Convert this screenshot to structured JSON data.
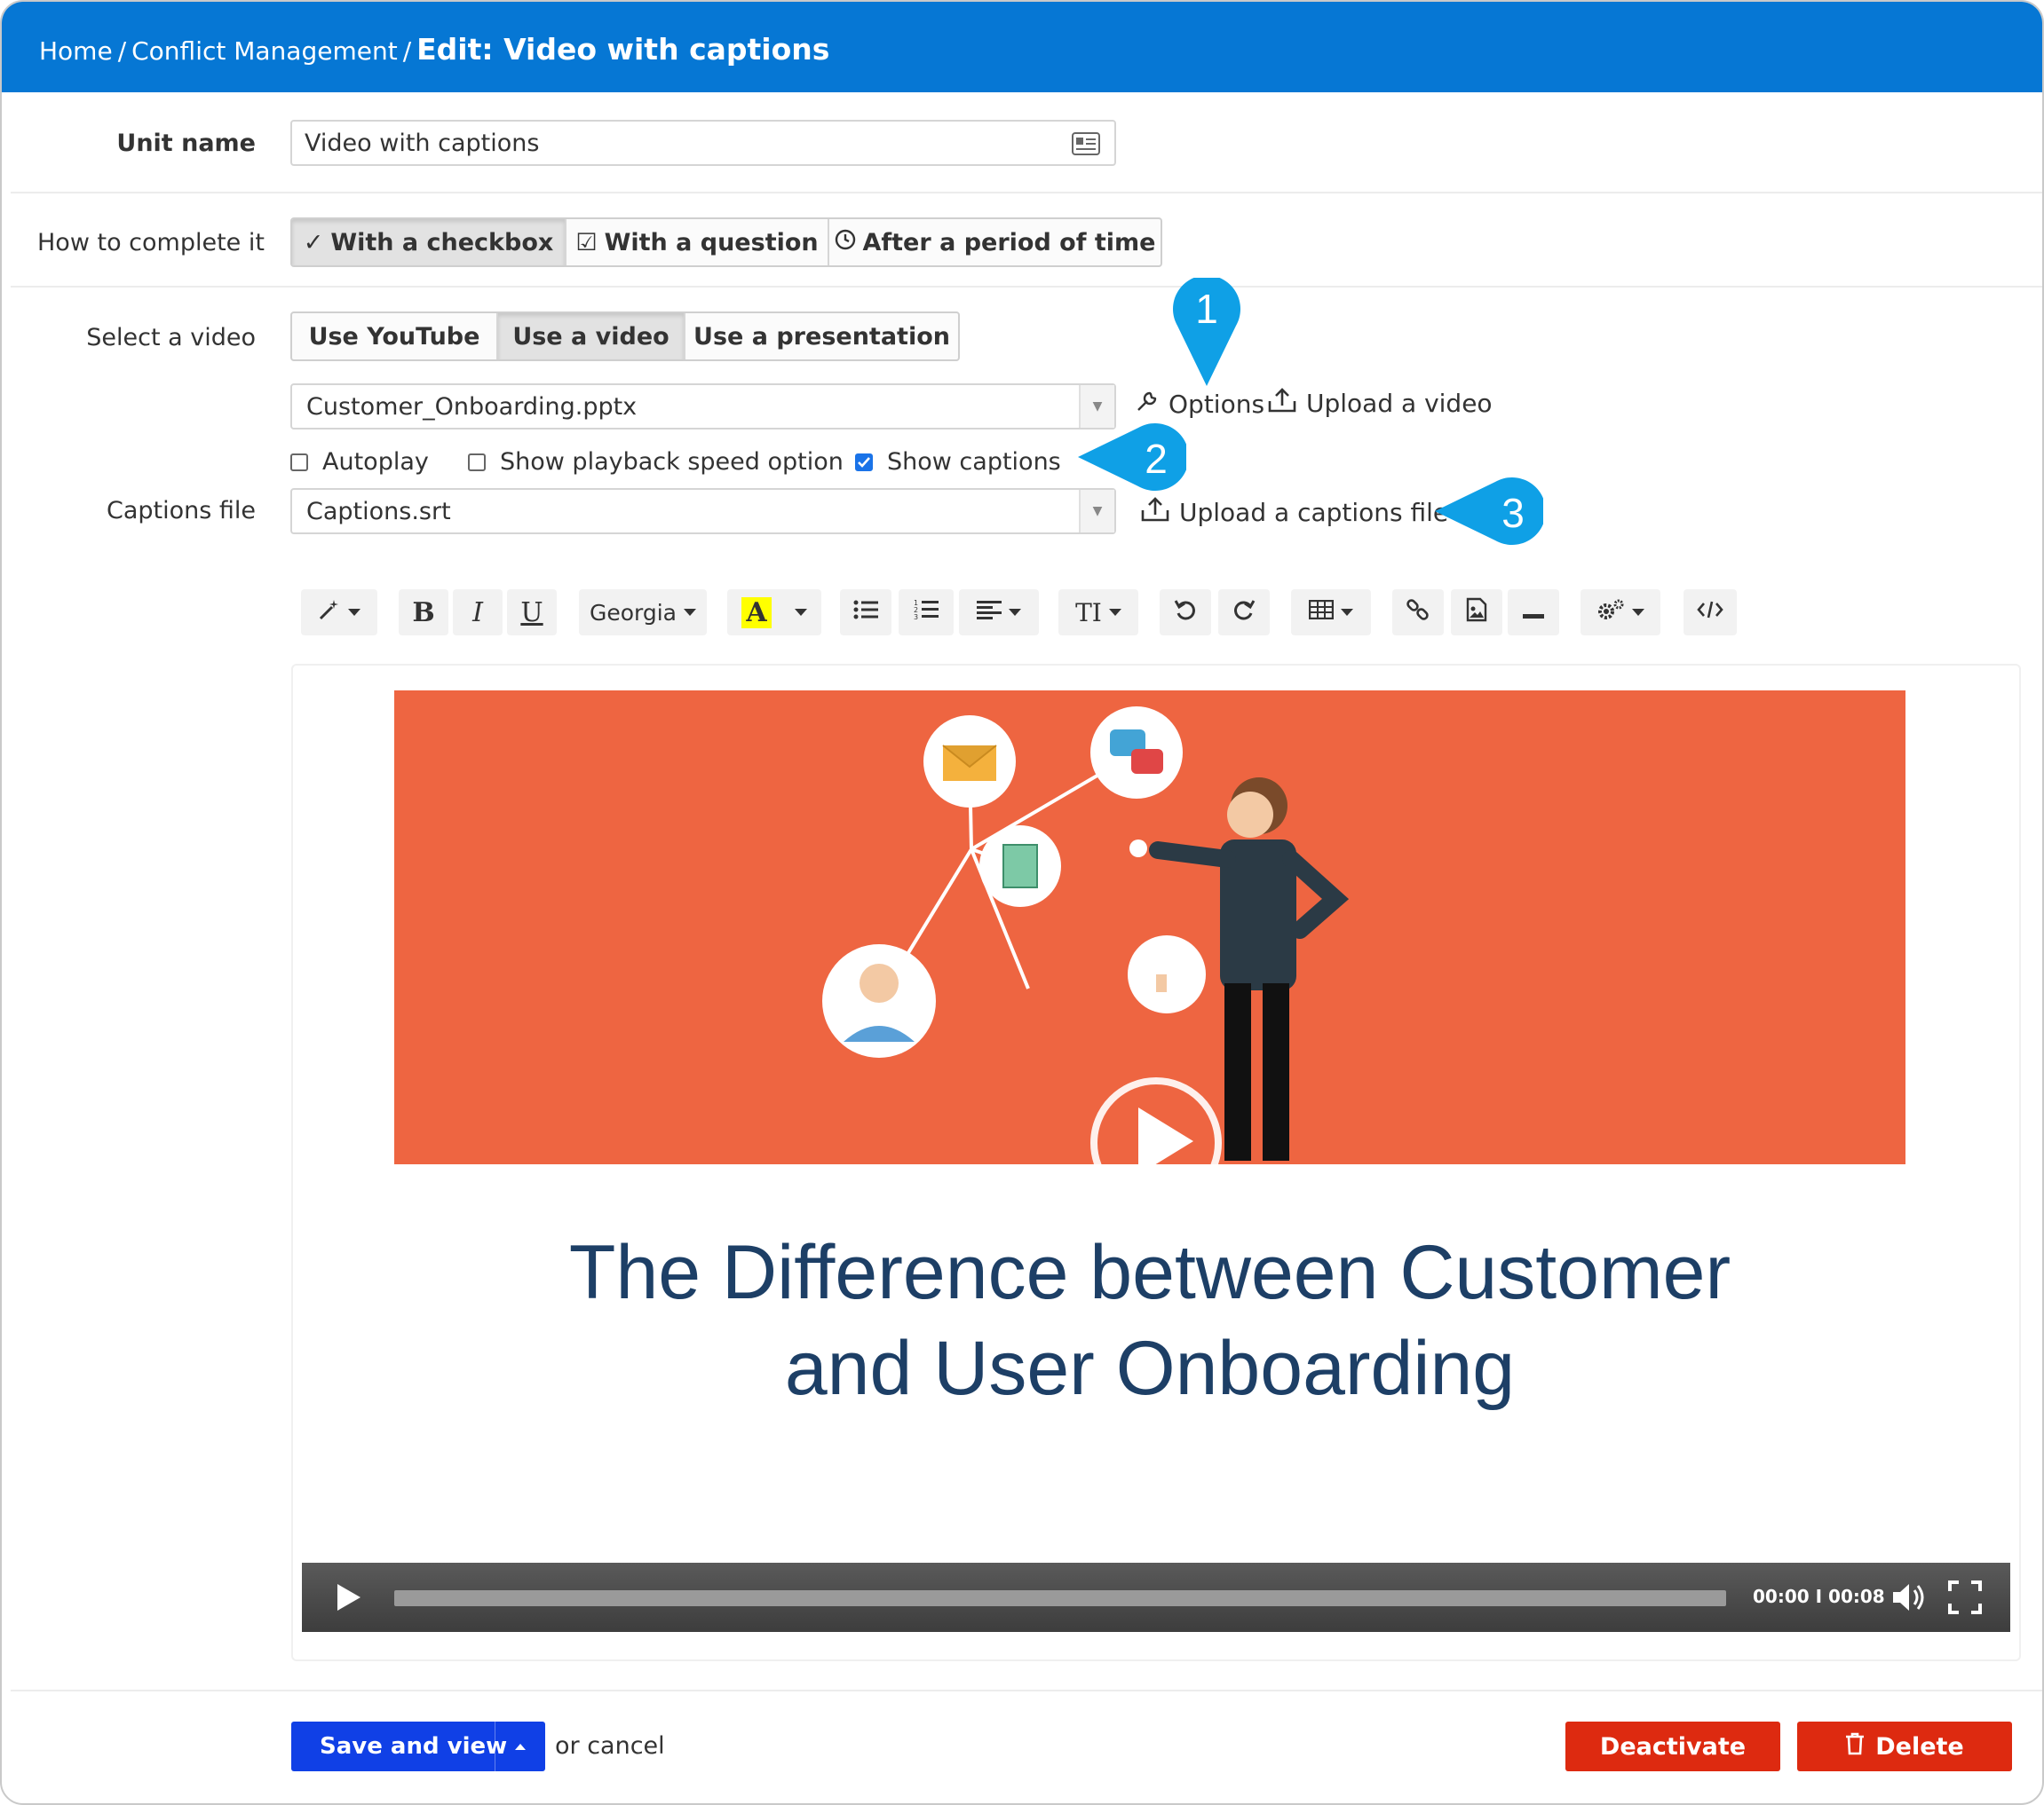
{
  "header": {
    "crumbs": [
      "Home",
      "Conflict Management"
    ],
    "separator": "/",
    "current": "Edit: Video with captions"
  },
  "unit_name": {
    "label": "Unit name",
    "value": "Video with captions",
    "icon": "id-card-icon"
  },
  "completion": {
    "label": "How to complete it",
    "options": [
      {
        "label": "With a checkbox",
        "icon": "checkmark-icon",
        "active": true
      },
      {
        "label": "With a question",
        "icon": "checkbox-icon",
        "active": false
      },
      {
        "label": "After a period of time",
        "icon": "clock-icon",
        "active": false
      }
    ]
  },
  "video": {
    "label": "Select a video",
    "sources": [
      {
        "label": "Use YouTube",
        "active": false
      },
      {
        "label": "Use a video",
        "active": true
      },
      {
        "label": "Use a presentation",
        "active": false
      }
    ],
    "file": "Customer_Onboarding.pptx",
    "options_label": "Options",
    "upload_label": "Upload a video",
    "checks": [
      {
        "label": "Autoplay",
        "checked": false
      },
      {
        "label": "Show playback speed option",
        "checked": false
      },
      {
        "label": "Show captions",
        "checked": true
      }
    ]
  },
  "captions": {
    "label": "Captions file",
    "file": "Captions.srt",
    "upload_label": "Upload a captions file"
  },
  "callouts": [
    "1",
    "2",
    "3"
  ],
  "toolbar": {
    "font": "Georgia",
    "bold": "B",
    "italic": "I",
    "underline": "U",
    "color": "A",
    "textsize": "TI",
    "highlight_color": "#ffff00"
  },
  "slide": {
    "title_line1": "The Difference between Customer",
    "title_line2": "and User Onboarding",
    "background": "#ee6541",
    "title_color": "#1d3f66"
  },
  "player": {
    "time": "00:00 I 00:08"
  },
  "footer": {
    "save_label": "Save and view",
    "cancel_label": "or cancel",
    "deactivate_label": "Deactivate",
    "delete_label": "Delete"
  },
  "colors": {
    "header": "#0677d4",
    "callout": "#0fa0e6",
    "primary": "#1040e6",
    "danger": "#dd2a10"
  }
}
